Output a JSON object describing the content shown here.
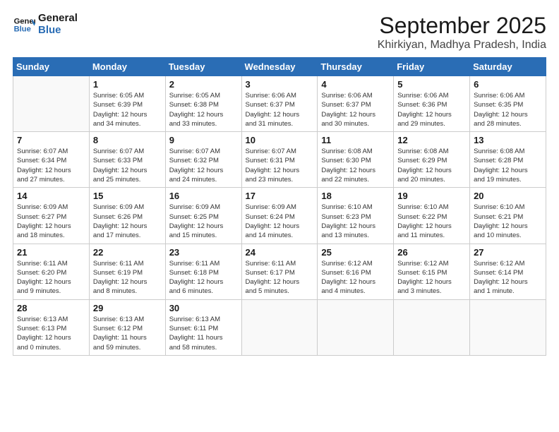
{
  "header": {
    "logo_line1": "General",
    "logo_line2": "Blue",
    "month": "September 2025",
    "location": "Khirkiyan, Madhya Pradesh, India"
  },
  "weekdays": [
    "Sunday",
    "Monday",
    "Tuesday",
    "Wednesday",
    "Thursday",
    "Friday",
    "Saturday"
  ],
  "weeks": [
    [
      {
        "day": "",
        "info": ""
      },
      {
        "day": "1",
        "info": "Sunrise: 6:05 AM\nSunset: 6:39 PM\nDaylight: 12 hours\nand 34 minutes."
      },
      {
        "day": "2",
        "info": "Sunrise: 6:05 AM\nSunset: 6:38 PM\nDaylight: 12 hours\nand 33 minutes."
      },
      {
        "day": "3",
        "info": "Sunrise: 6:06 AM\nSunset: 6:37 PM\nDaylight: 12 hours\nand 31 minutes."
      },
      {
        "day": "4",
        "info": "Sunrise: 6:06 AM\nSunset: 6:37 PM\nDaylight: 12 hours\nand 30 minutes."
      },
      {
        "day": "5",
        "info": "Sunrise: 6:06 AM\nSunset: 6:36 PM\nDaylight: 12 hours\nand 29 minutes."
      },
      {
        "day": "6",
        "info": "Sunrise: 6:06 AM\nSunset: 6:35 PM\nDaylight: 12 hours\nand 28 minutes."
      }
    ],
    [
      {
        "day": "7",
        "info": "Sunrise: 6:07 AM\nSunset: 6:34 PM\nDaylight: 12 hours\nand 27 minutes."
      },
      {
        "day": "8",
        "info": "Sunrise: 6:07 AM\nSunset: 6:33 PM\nDaylight: 12 hours\nand 25 minutes."
      },
      {
        "day": "9",
        "info": "Sunrise: 6:07 AM\nSunset: 6:32 PM\nDaylight: 12 hours\nand 24 minutes."
      },
      {
        "day": "10",
        "info": "Sunrise: 6:07 AM\nSunset: 6:31 PM\nDaylight: 12 hours\nand 23 minutes."
      },
      {
        "day": "11",
        "info": "Sunrise: 6:08 AM\nSunset: 6:30 PM\nDaylight: 12 hours\nand 22 minutes."
      },
      {
        "day": "12",
        "info": "Sunrise: 6:08 AM\nSunset: 6:29 PM\nDaylight: 12 hours\nand 20 minutes."
      },
      {
        "day": "13",
        "info": "Sunrise: 6:08 AM\nSunset: 6:28 PM\nDaylight: 12 hours\nand 19 minutes."
      }
    ],
    [
      {
        "day": "14",
        "info": "Sunrise: 6:09 AM\nSunset: 6:27 PM\nDaylight: 12 hours\nand 18 minutes."
      },
      {
        "day": "15",
        "info": "Sunrise: 6:09 AM\nSunset: 6:26 PM\nDaylight: 12 hours\nand 17 minutes."
      },
      {
        "day": "16",
        "info": "Sunrise: 6:09 AM\nSunset: 6:25 PM\nDaylight: 12 hours\nand 15 minutes."
      },
      {
        "day": "17",
        "info": "Sunrise: 6:09 AM\nSunset: 6:24 PM\nDaylight: 12 hours\nand 14 minutes."
      },
      {
        "day": "18",
        "info": "Sunrise: 6:10 AM\nSunset: 6:23 PM\nDaylight: 12 hours\nand 13 minutes."
      },
      {
        "day": "19",
        "info": "Sunrise: 6:10 AM\nSunset: 6:22 PM\nDaylight: 12 hours\nand 11 minutes."
      },
      {
        "day": "20",
        "info": "Sunrise: 6:10 AM\nSunset: 6:21 PM\nDaylight: 12 hours\nand 10 minutes."
      }
    ],
    [
      {
        "day": "21",
        "info": "Sunrise: 6:11 AM\nSunset: 6:20 PM\nDaylight: 12 hours\nand 9 minutes."
      },
      {
        "day": "22",
        "info": "Sunrise: 6:11 AM\nSunset: 6:19 PM\nDaylight: 12 hours\nand 8 minutes."
      },
      {
        "day": "23",
        "info": "Sunrise: 6:11 AM\nSunset: 6:18 PM\nDaylight: 12 hours\nand 6 minutes."
      },
      {
        "day": "24",
        "info": "Sunrise: 6:11 AM\nSunset: 6:17 PM\nDaylight: 12 hours\nand 5 minutes."
      },
      {
        "day": "25",
        "info": "Sunrise: 6:12 AM\nSunset: 6:16 PM\nDaylight: 12 hours\nand 4 minutes."
      },
      {
        "day": "26",
        "info": "Sunrise: 6:12 AM\nSunset: 6:15 PM\nDaylight: 12 hours\nand 3 minutes."
      },
      {
        "day": "27",
        "info": "Sunrise: 6:12 AM\nSunset: 6:14 PM\nDaylight: 12 hours\nand 1 minute."
      }
    ],
    [
      {
        "day": "28",
        "info": "Sunrise: 6:13 AM\nSunset: 6:13 PM\nDaylight: 12 hours\nand 0 minutes."
      },
      {
        "day": "29",
        "info": "Sunrise: 6:13 AM\nSunset: 6:12 PM\nDaylight: 11 hours\nand 59 minutes."
      },
      {
        "day": "30",
        "info": "Sunrise: 6:13 AM\nSunset: 6:11 PM\nDaylight: 11 hours\nand 58 minutes."
      },
      {
        "day": "",
        "info": ""
      },
      {
        "day": "",
        "info": ""
      },
      {
        "day": "",
        "info": ""
      },
      {
        "day": "",
        "info": ""
      }
    ]
  ]
}
